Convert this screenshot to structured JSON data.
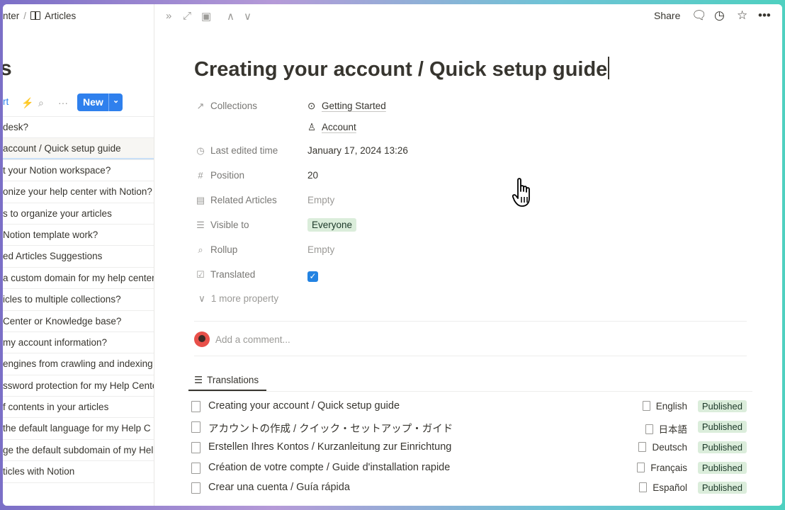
{
  "breadcrumb": {
    "parent": "nter",
    "separator": "/",
    "current": "Articles"
  },
  "left_pane": {
    "title": "s",
    "toolbar": {
      "sort_label": "rt",
      "new_label": "New"
    },
    "items": [
      {
        "label": "desk?"
      },
      {
        "label": "account / Quick setup guide"
      },
      {
        "label": "t your Notion workspace?"
      },
      {
        "label": "onize your help center with Notion?"
      },
      {
        "label": "s to organize your articles"
      },
      {
        "label": "Notion template work?"
      },
      {
        "label": "ed Articles Suggestions"
      },
      {
        "label": "a custom domain for my help center"
      },
      {
        "label": "icles to multiple collections?"
      },
      {
        "label": "Center or Knowledge base?"
      },
      {
        "label": "my account information?"
      },
      {
        "label": "engines from crawling and indexing"
      },
      {
        "label": "ssword protection for my Help Cente"
      },
      {
        "label": "f contents in your articles"
      },
      {
        "label": "the default language for my Help C"
      },
      {
        "label": "ge the default subdomain of my Help"
      },
      {
        "label": "ticles with Notion"
      }
    ]
  },
  "topbar": {
    "share_label": "Share"
  },
  "page": {
    "title": "Creating your account / Quick setup guide",
    "properties": {
      "collections": {
        "name": "Collections",
        "values": [
          "Getting Started",
          "Account"
        ]
      },
      "last_edited": {
        "name": "Last edited time",
        "value": "January 17, 2024 13:26"
      },
      "position": {
        "name": "Position",
        "value": "20"
      },
      "related": {
        "name": "Related Articles",
        "value": "Empty"
      },
      "visible": {
        "name": "Visible to",
        "value": "Everyone"
      },
      "rollup": {
        "name": "Rollup",
        "value": "Empty"
      },
      "translated": {
        "name": "Translated",
        "checked": true
      }
    },
    "more_property": "1 more property",
    "comment_placeholder": "Add a comment...",
    "translations_tab": "Translations",
    "translations": [
      {
        "title": "Creating your account / Quick setup guide",
        "language": "English",
        "status": "Published"
      },
      {
        "title": "アカウントの作成 / クイック・セットアップ・ガイド",
        "language": "日本語",
        "status": "Published"
      },
      {
        "title": "Erstellen Ihres Kontos / Kurzanleitung zur Einrichtung",
        "language": "Deutsch",
        "status": "Published"
      },
      {
        "title": "Création de votre compte / Guide d'installation rapide",
        "language": "Français",
        "status": "Published"
      },
      {
        "title": "Crear una cuenta / Guía rápida",
        "language": "Español",
        "status": "Published"
      }
    ]
  },
  "colors": {
    "accent": "#2f80ed",
    "published_bg": "#dbeddb",
    "tag_bg": "#dbeddb"
  }
}
